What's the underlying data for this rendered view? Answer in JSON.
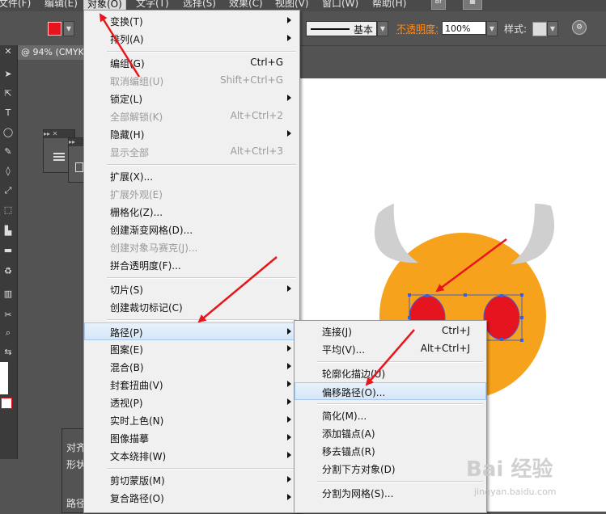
{
  "menubar": {
    "items": [
      {
        "label": "文件(F)"
      },
      {
        "label": "编辑(E)"
      },
      {
        "label": "对象(O)"
      },
      {
        "label": "文字(T)"
      },
      {
        "label": "选择(S)"
      },
      {
        "label": "效果(C)"
      },
      {
        "label": "视图(V)"
      },
      {
        "label": "窗口(W)"
      },
      {
        "label": "帮助(H)"
      }
    ],
    "bridge": "Br"
  },
  "controlbar": {
    "stroke_style": "基本",
    "opacity_label": "不透明度:",
    "opacity_value": "100%",
    "style_label": "样式:"
  },
  "doc_tab": "@ 94% (CMYK",
  "colors": {
    "ui_bg": "#535353",
    "menu_bg": "#f0f0f0",
    "highlight": "#d6e6f8",
    "fill_red": "#e5141f",
    "face_orange": "#f7a21c",
    "horn_gray": "#cfcfcf",
    "arrow_red": "#e8161c",
    "selection_blue": "#3b5fd8"
  },
  "object_menu": {
    "items": [
      {
        "label": "变换(T)",
        "shortcut": "",
        "submenu": true,
        "disabled": false
      },
      {
        "label": "排列(A)",
        "shortcut": "",
        "submenu": true,
        "disabled": false
      },
      {
        "label": "编组(G)",
        "shortcut": "Ctrl+G",
        "submenu": false,
        "disabled": false
      },
      {
        "label": "取消编组(U)",
        "shortcut": "Shift+Ctrl+G",
        "submenu": false,
        "disabled": true
      },
      {
        "label": "锁定(L)",
        "shortcut": "",
        "submenu": true,
        "disabled": false
      },
      {
        "label": "全部解锁(K)",
        "shortcut": "Alt+Ctrl+2",
        "submenu": false,
        "disabled": true
      },
      {
        "label": "隐藏(H)",
        "shortcut": "",
        "submenu": true,
        "disabled": false
      },
      {
        "label": "显示全部",
        "shortcut": "Alt+Ctrl+3",
        "submenu": false,
        "disabled": true
      },
      {
        "label": "扩展(X)...",
        "shortcut": "",
        "submenu": false,
        "disabled": false
      },
      {
        "label": "扩展外观(E)",
        "shortcut": "",
        "submenu": false,
        "disabled": true
      },
      {
        "label": "栅格化(Z)...",
        "shortcut": "",
        "submenu": false,
        "disabled": false
      },
      {
        "label": "创建渐变网格(D)...",
        "shortcut": "",
        "submenu": false,
        "disabled": false
      },
      {
        "label": "创建对象马赛克(J)...",
        "shortcut": "",
        "submenu": false,
        "disabled": true
      },
      {
        "label": "拼合透明度(F)...",
        "shortcut": "",
        "submenu": false,
        "disabled": false
      },
      {
        "label": "切片(S)",
        "shortcut": "",
        "submenu": true,
        "disabled": false
      },
      {
        "label": "创建裁切标记(C)",
        "shortcut": "",
        "submenu": false,
        "disabled": false
      },
      {
        "label": "路径(P)",
        "shortcut": "",
        "submenu": true,
        "disabled": false,
        "highlighted": true
      },
      {
        "label": "图案(E)",
        "shortcut": "",
        "submenu": true,
        "disabled": false
      },
      {
        "label": "混合(B)",
        "shortcut": "",
        "submenu": true,
        "disabled": false
      },
      {
        "label": "封套扭曲(V)",
        "shortcut": "",
        "submenu": true,
        "disabled": false
      },
      {
        "label": "透视(P)",
        "shortcut": "",
        "submenu": true,
        "disabled": false
      },
      {
        "label": "实时上色(N)",
        "shortcut": "",
        "submenu": true,
        "disabled": false
      },
      {
        "label": "图像描摹",
        "shortcut": "",
        "submenu": true,
        "disabled": false
      },
      {
        "label": "文本绕排(W)",
        "shortcut": "",
        "submenu": true,
        "disabled": false
      },
      {
        "label": "剪切蒙版(M)",
        "shortcut": "",
        "submenu": true,
        "disabled": false
      },
      {
        "label": "复合路径(O)",
        "shortcut": "",
        "submenu": true,
        "disabled": false
      }
    ]
  },
  "path_submenu": {
    "items": [
      {
        "label": "连接(J)",
        "shortcut": "Ctrl+J"
      },
      {
        "label": "平均(V)...",
        "shortcut": "Alt+Ctrl+J"
      },
      {
        "label": "轮廓化描边(U)",
        "shortcut": ""
      },
      {
        "label": "偏移路径(O)...",
        "shortcut": "",
        "highlighted": true
      },
      {
        "label": "简化(M)...",
        "shortcut": ""
      },
      {
        "label": "添加锚点(A)",
        "shortcut": ""
      },
      {
        "label": "移去锚点(R)",
        "shortcut": ""
      },
      {
        "label": "分割下方对象(D)",
        "shortcut": ""
      },
      {
        "label": "分割为网格(S)...",
        "shortcut": ""
      }
    ]
  },
  "bottom_panel": {
    "title": "对齐",
    "row1": "形状",
    "row2": "路径"
  },
  "watermark": {
    "logo_text": "Bai 经验",
    "url": "jingyan.baidu.com"
  }
}
